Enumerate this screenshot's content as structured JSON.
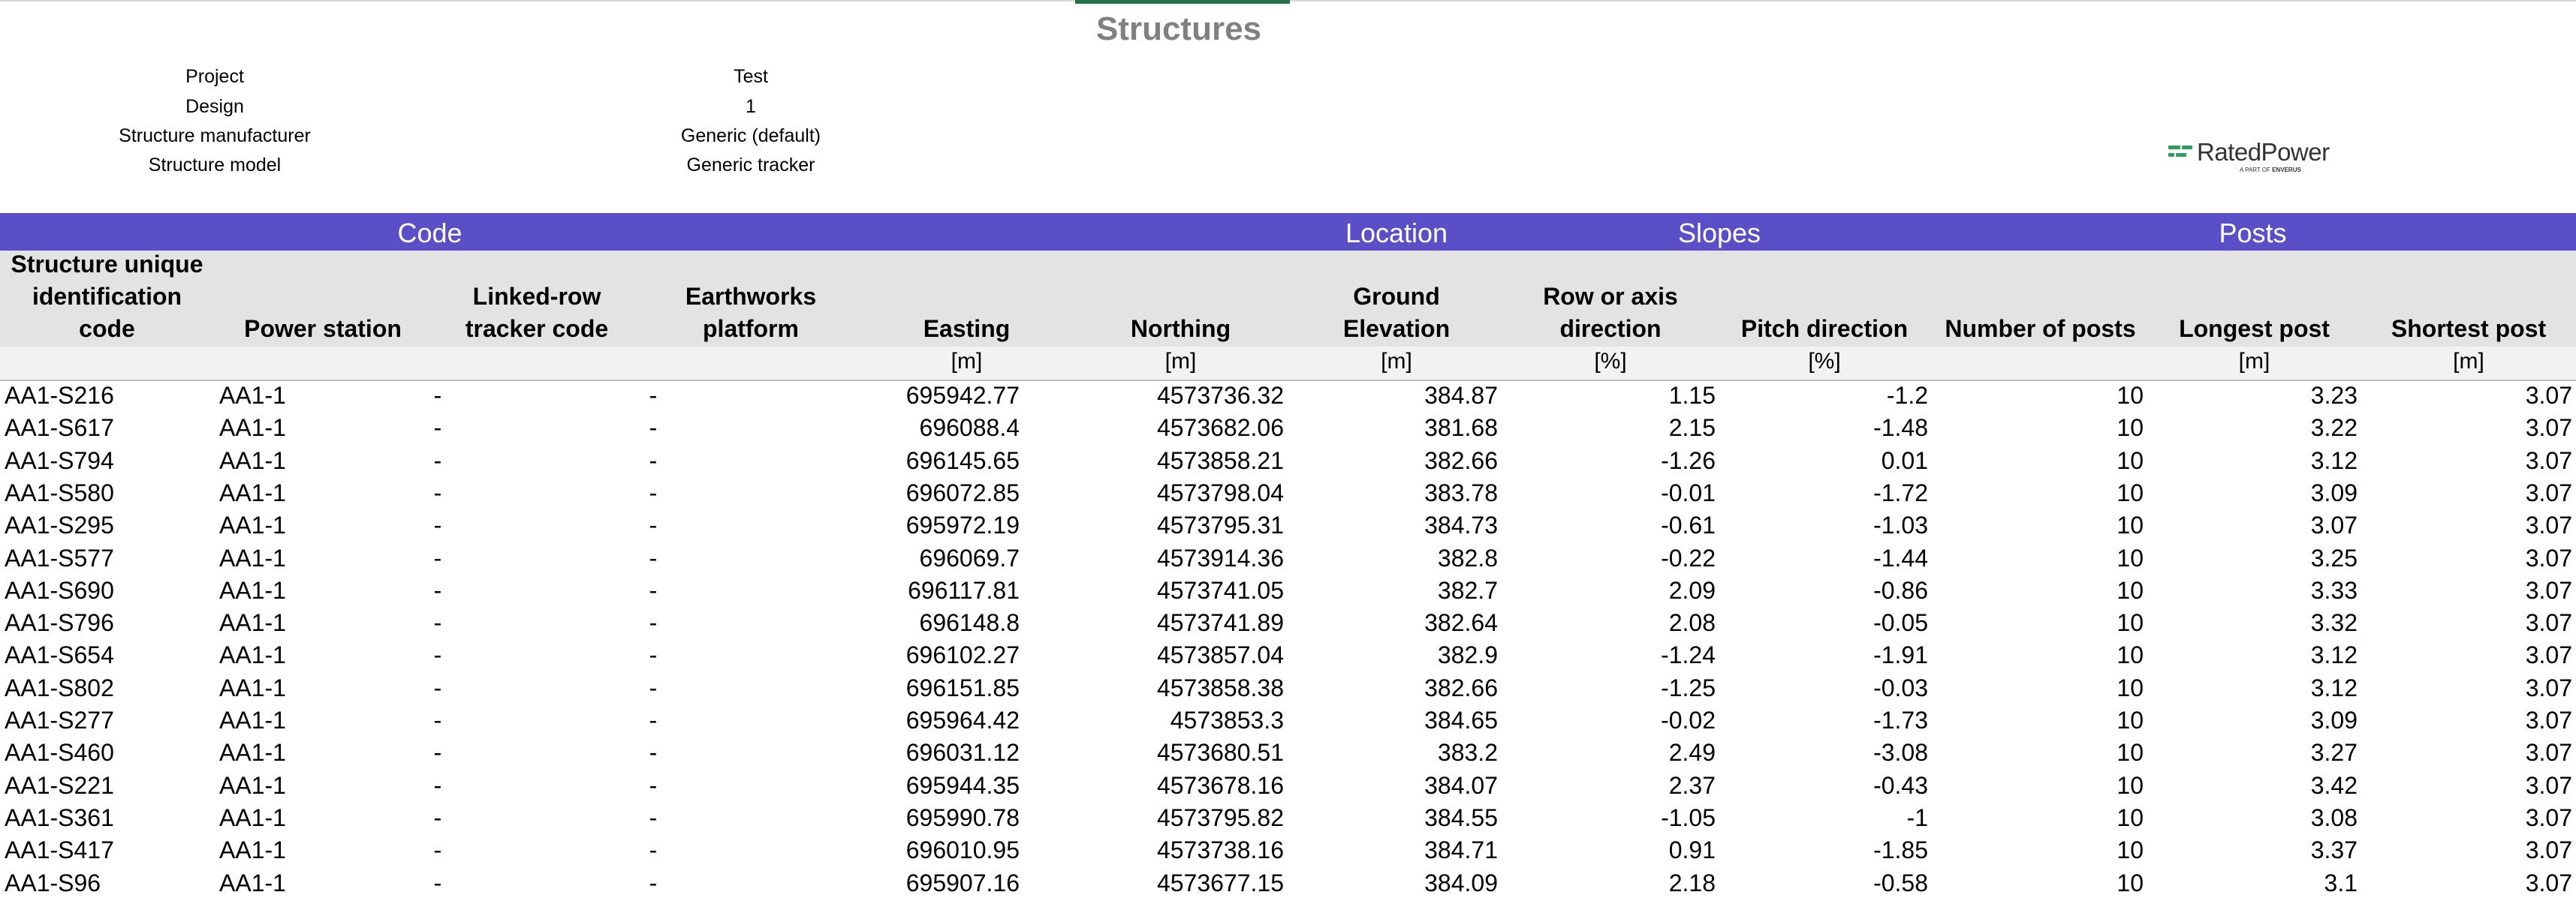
{
  "title": "Structures",
  "meta": [
    {
      "label": "Project",
      "value": "Test"
    },
    {
      "label": "Design",
      "value": "1"
    },
    {
      "label": "Structure manufacturer",
      "value": "Generic (default)"
    },
    {
      "label": "Structure model",
      "value": "Generic tracker"
    }
  ],
  "logo": {
    "brand": "RatedPower",
    "sub_prefix": "A PART OF",
    "sub_brand": "ENVERUS"
  },
  "groups": [
    "Code",
    "Location",
    "Slopes",
    "Posts"
  ],
  "headers": {
    "uid": [
      "Structure unique",
      "identification",
      "code"
    ],
    "power_station": [
      "Power station"
    ],
    "linked_row": [
      "Linked-row",
      "tracker code"
    ],
    "earthworks": [
      "Earthworks",
      "platform"
    ],
    "easting": [
      "Easting"
    ],
    "northing": [
      "Northing"
    ],
    "elevation": [
      "Ground",
      "Elevation"
    ],
    "row_dir": [
      "Row or axis",
      "direction"
    ],
    "pitch": [
      "Pitch direction"
    ],
    "num_posts": [
      "Number of posts"
    ],
    "longest": [
      "Longest post"
    ],
    "shortest": [
      "Shortest post"
    ]
  },
  "units": {
    "easting": "[m]",
    "northing": "[m]",
    "elevation": "[m]",
    "row_dir": "[%]",
    "pitch": "[%]",
    "longest": "[m]",
    "shortest": "[m]"
  },
  "rows": [
    [
      "AA1-S216",
      "AA1-1",
      "-",
      "-",
      "695942.77",
      "4573736.32",
      "384.87",
      "1.15",
      "-1.2",
      "10",
      "3.23",
      "3.07"
    ],
    [
      "AA1-S617",
      "AA1-1",
      "-",
      "-",
      "696088.4",
      "4573682.06",
      "381.68",
      "2.15",
      "-1.48",
      "10",
      "3.22",
      "3.07"
    ],
    [
      "AA1-S794",
      "AA1-1",
      "-",
      "-",
      "696145.65",
      "4573858.21",
      "382.66",
      "-1.26",
      "0.01",
      "10",
      "3.12",
      "3.07"
    ],
    [
      "AA1-S580",
      "AA1-1",
      "-",
      "-",
      "696072.85",
      "4573798.04",
      "383.78",
      "-0.01",
      "-1.72",
      "10",
      "3.09",
      "3.07"
    ],
    [
      "AA1-S295",
      "AA1-1",
      "-",
      "-",
      "695972.19",
      "4573795.31",
      "384.73",
      "-0.61",
      "-1.03",
      "10",
      "3.07",
      "3.07"
    ],
    [
      "AA1-S577",
      "AA1-1",
      "-",
      "-",
      "696069.7",
      "4573914.36",
      "382.8",
      "-0.22",
      "-1.44",
      "10",
      "3.25",
      "3.07"
    ],
    [
      "AA1-S690",
      "AA1-1",
      "-",
      "-",
      "696117.81",
      "4573741.05",
      "382.7",
      "2.09",
      "-0.86",
      "10",
      "3.33",
      "3.07"
    ],
    [
      "AA1-S796",
      "AA1-1",
      "-",
      "-",
      "696148.8",
      "4573741.89",
      "382.64",
      "2.08",
      "-0.05",
      "10",
      "3.32",
      "3.07"
    ],
    [
      "AA1-S654",
      "AA1-1",
      "-",
      "-",
      "696102.27",
      "4573857.04",
      "382.9",
      "-1.24",
      "-1.91",
      "10",
      "3.12",
      "3.07"
    ],
    [
      "AA1-S802",
      "AA1-1",
      "-",
      "-",
      "696151.85",
      "4573858.38",
      "382.66",
      "-1.25",
      "-0.03",
      "10",
      "3.12",
      "3.07"
    ],
    [
      "AA1-S277",
      "AA1-1",
      "-",
      "-",
      "695964.42",
      "4573853.3",
      "384.65",
      "-0.02",
      "-1.73",
      "10",
      "3.09",
      "3.07"
    ],
    [
      "AA1-S460",
      "AA1-1",
      "-",
      "-",
      "696031.12",
      "4573680.51",
      "383.2",
      "2.49",
      "-3.08",
      "10",
      "3.27",
      "3.07"
    ],
    [
      "AA1-S221",
      "AA1-1",
      "-",
      "-",
      "695944.35",
      "4573678.16",
      "384.07",
      "2.37",
      "-0.43",
      "10",
      "3.42",
      "3.07"
    ],
    [
      "AA1-S361",
      "AA1-1",
      "-",
      "-",
      "695990.78",
      "4573795.82",
      "384.55",
      "-1.05",
      "-1",
      "10",
      "3.08",
      "3.07"
    ],
    [
      "AA1-S417",
      "AA1-1",
      "-",
      "-",
      "696010.95",
      "4573738.16",
      "384.71",
      "0.91",
      "-1.85",
      "10",
      "3.37",
      "3.07"
    ],
    [
      "AA1-S96",
      "AA1-1",
      "-",
      "-",
      "695907.16",
      "4573677.15",
      "384.09",
      "2.18",
      "-0.58",
      "10",
      "3.1",
      "3.07"
    ]
  ],
  "colors": {
    "group_bar": "#5b4fc7",
    "header_bg": "#e3e3e3",
    "title": "#808080",
    "logo_green": "#2e9e5b"
  }
}
